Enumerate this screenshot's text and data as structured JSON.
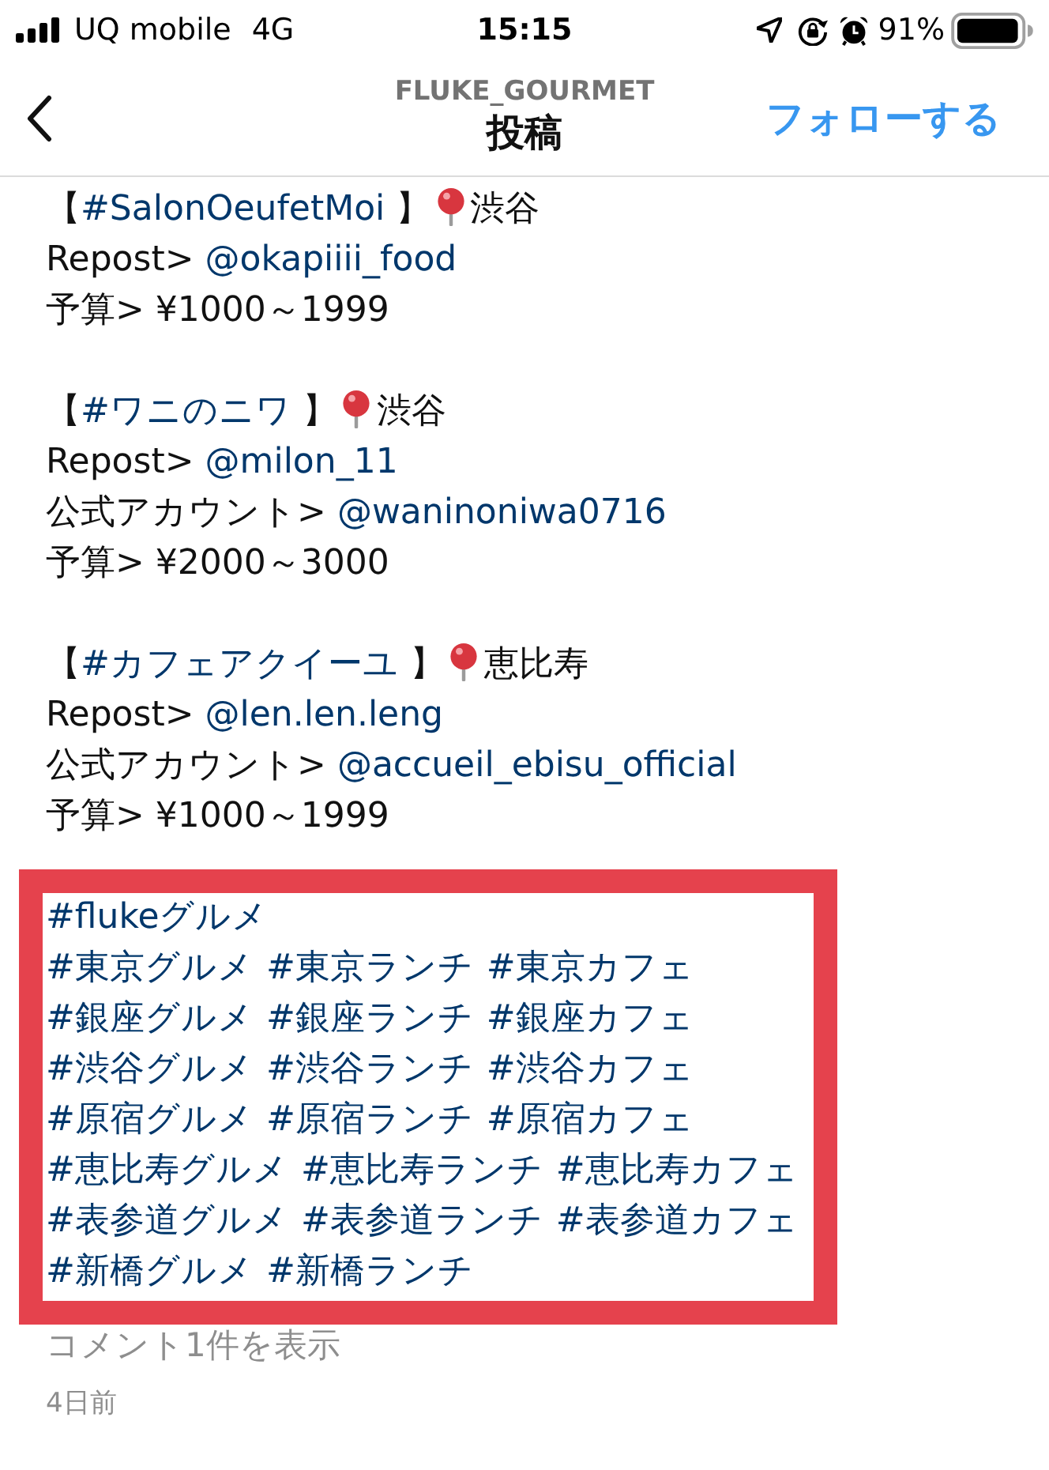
{
  "status_bar": {
    "carrier": "UQ mobile",
    "network": "4G",
    "time": "15:15",
    "battery": "91%"
  },
  "header": {
    "username": "FLUKE_GOURMET",
    "title": "投稿",
    "follow_button": "フォローする"
  },
  "caption": {
    "blocks": [
      {
        "lines": [
          {
            "segments": [
              {
                "kind": "text",
                "text": "【"
              },
              {
                "kind": "hashtag",
                "text": "#SalonOeufetMoi"
              },
              {
                "kind": "text",
                "text": " 】"
              },
              {
                "kind": "pin"
              },
              {
                "kind": "text",
                "text": "渋谷"
              }
            ]
          },
          {
            "segments": [
              {
                "kind": "text",
                "text": "Repost> "
              },
              {
                "kind": "mention",
                "text": "@okapiiii_food"
              }
            ]
          },
          {
            "segments": [
              {
                "kind": "text",
                "text": "予算> ¥1000～1999"
              }
            ]
          }
        ]
      },
      {
        "lines": [
          {
            "segments": [
              {
                "kind": "text",
                "text": "【"
              },
              {
                "kind": "hashtag",
                "text": "#ワニのニワ"
              },
              {
                "kind": "text",
                "text": " 】"
              },
              {
                "kind": "pin"
              },
              {
                "kind": "text",
                "text": "渋谷"
              }
            ]
          },
          {
            "segments": [
              {
                "kind": "text",
                "text": "Repost> "
              },
              {
                "kind": "mention",
                "text": "@milon_11"
              }
            ]
          },
          {
            "segments": [
              {
                "kind": "text",
                "text": "公式アカウント> "
              },
              {
                "kind": "mention",
                "text": "@waninoniwa0716"
              }
            ]
          },
          {
            "segments": [
              {
                "kind": "text",
                "text": "予算> ¥2000～3000"
              }
            ]
          }
        ]
      },
      {
        "lines": [
          {
            "segments": [
              {
                "kind": "text",
                "text": "【"
              },
              {
                "kind": "hashtag",
                "text": "#カフェアクイーユ"
              },
              {
                "kind": "text",
                "text": " 】"
              },
              {
                "kind": "pin"
              },
              {
                "kind": "text",
                "text": "恵比寿"
              }
            ]
          },
          {
            "segments": [
              {
                "kind": "text",
                "text": "Repost> "
              },
              {
                "kind": "mention",
                "text": "@len.len.leng"
              }
            ]
          },
          {
            "segments": [
              {
                "kind": "text",
                "text": "公式アカウント> "
              },
              {
                "kind": "mention",
                "text": "@accueil_ebisu_official"
              }
            ]
          },
          {
            "segments": [
              {
                "kind": "text",
                "text": "予算> ¥1000～1999"
              }
            ]
          }
        ]
      }
    ]
  },
  "hashtags": {
    "highlighted": true,
    "lines": [
      [
        "#flukeグルメ"
      ],
      [
        "#東京グルメ",
        "#東京ランチ",
        "#東京カフェ"
      ],
      [
        "#銀座グルメ",
        "#銀座ランチ",
        "#銀座カフェ"
      ],
      [
        "#渋谷グルメ",
        "#渋谷ランチ",
        "#渋谷カフェ"
      ],
      [
        "#原宿グルメ",
        "#原宿ランチ",
        "#原宿カフェ"
      ],
      [
        "#恵比寿グルメ",
        "#恵比寿ランチ",
        "#恵比寿カフェ"
      ],
      [
        "#表参道グルメ",
        "#表参道ランチ",
        "#表参道カフェ"
      ],
      [
        "#新橋グルメ",
        "#新橋ランチ"
      ]
    ]
  },
  "comments_link": "コメント1件を表示",
  "timestamp": "4日前"
}
